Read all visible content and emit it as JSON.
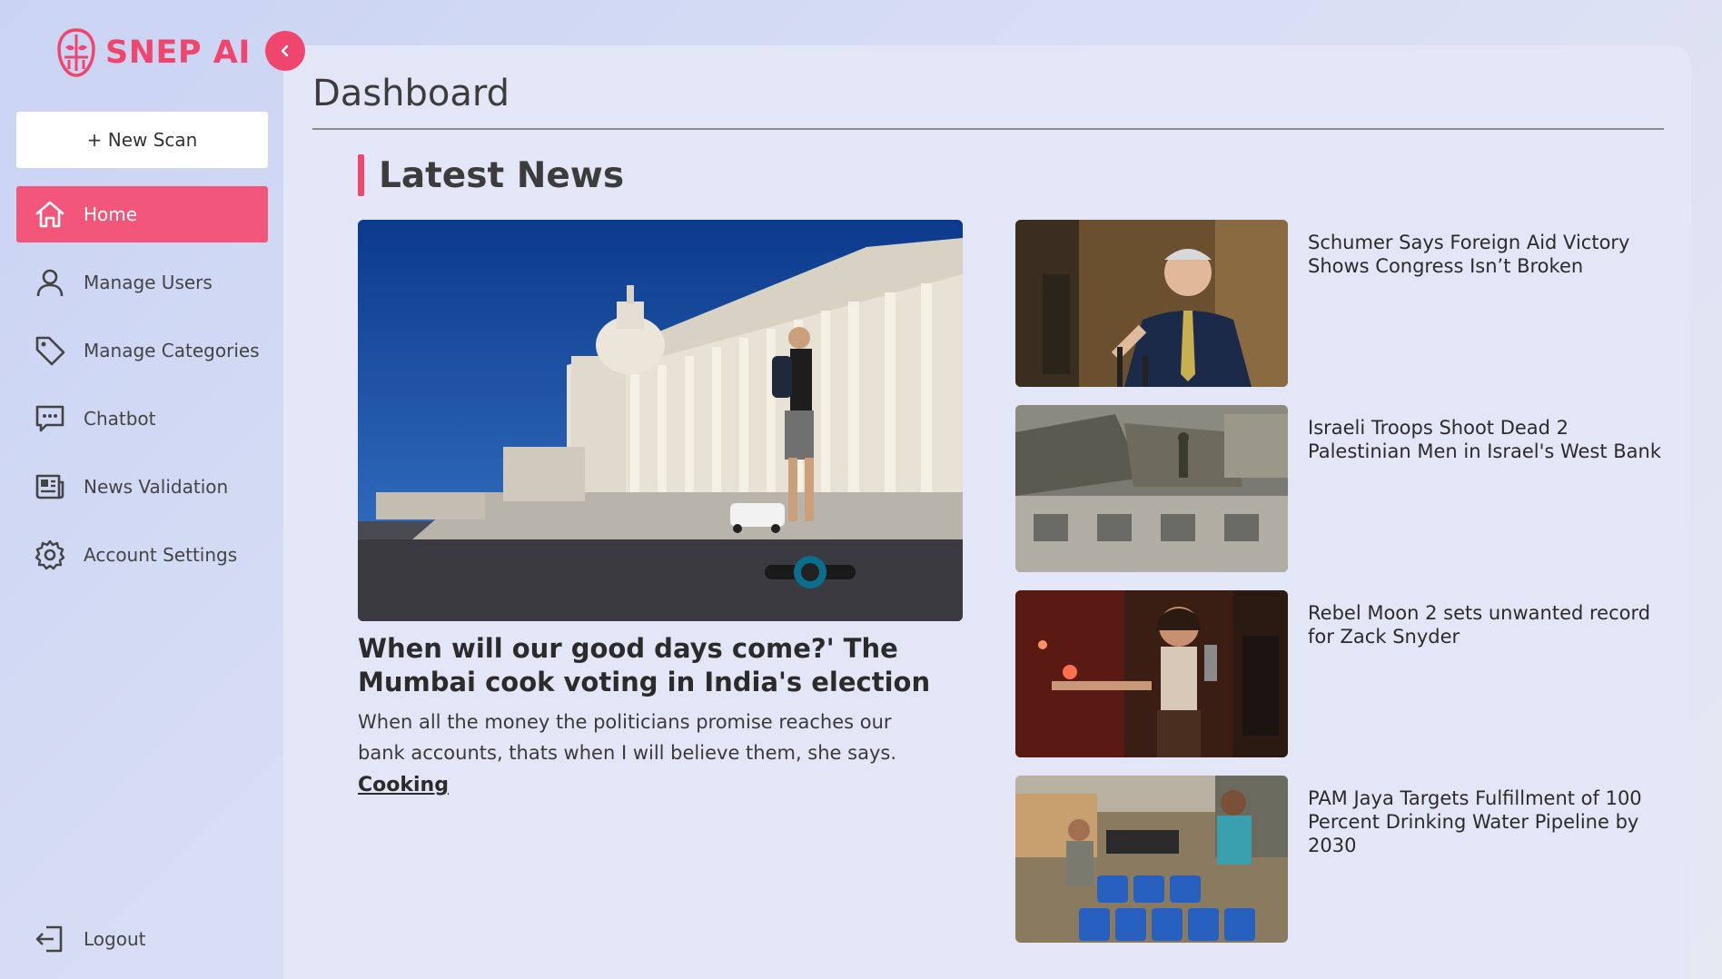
{
  "app": {
    "name": "SNEP AI",
    "accent": "#f0466e"
  },
  "sidebar": {
    "new_scan_label": "+ New Scan",
    "items": [
      {
        "label": "Home",
        "icon": "home-icon",
        "active": true
      },
      {
        "label": "Manage Users",
        "icon": "user-icon",
        "active": false
      },
      {
        "label": "Manage Categories",
        "icon": "tag-icon",
        "active": false
      },
      {
        "label": "Chatbot",
        "icon": "chat-icon",
        "active": false
      },
      {
        "label": "News Validation",
        "icon": "newspaper-icon",
        "active": false
      },
      {
        "label": "Account Settings",
        "icon": "gear-icon",
        "active": false
      }
    ],
    "logout_label": "Logout"
  },
  "main": {
    "page_title": "Dashboard",
    "section_title": "Latest News",
    "featured": {
      "headline": "When will our good days come?' The Mumbai cook voting in India's election",
      "description": "When all the money the politicians promise reaches our bank accounts, thats when I will believe them, she says.",
      "category": "Cooking",
      "image": "capitol-building-photo"
    },
    "side_news": [
      {
        "headline": "Schumer Says Foreign Aid Victory Shows Congress Isn’t Broken",
        "image": "senator-speaking-photo"
      },
      {
        "headline": "Israeli Troops Shoot Dead 2 Palestinian Men in Israel's West Bank",
        "image": "military-vehicles-photo"
      },
      {
        "headline": "Rebel Moon 2 sets unwanted record for Zack Snyder",
        "image": "movie-still-photo"
      },
      {
        "headline": "PAM Jaya Targets Fulfillment of 100 Percent Drinking Water Pipeline by 2030",
        "image": "water-containers-photo"
      }
    ]
  }
}
